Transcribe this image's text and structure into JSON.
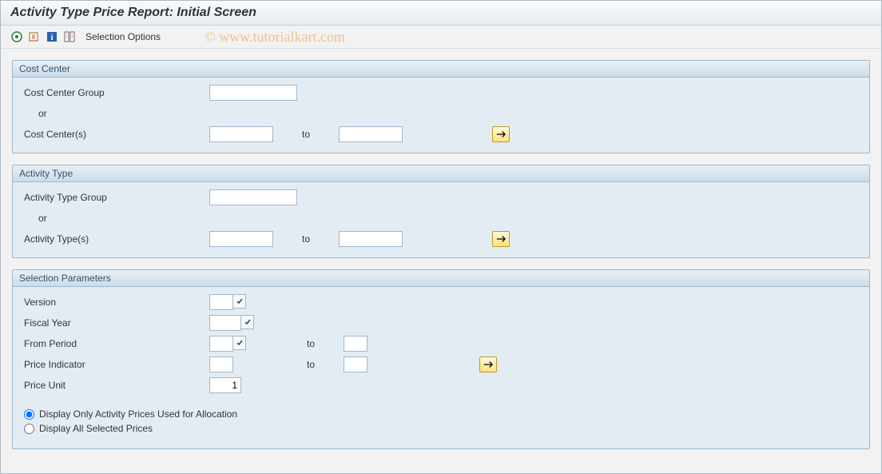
{
  "watermark": "© www.tutorialkart.com",
  "title": "Activity Type Price Report: Initial Screen",
  "toolbar": {
    "selection_options_label": "Selection Options"
  },
  "groups": {
    "cost_center": {
      "title": "Cost Center",
      "group_label": "Cost Center Group",
      "or_label": "or",
      "range_label": "Cost Center(s)",
      "to_label": "to",
      "group_value": "",
      "from_value": "",
      "to_value": ""
    },
    "activity_type": {
      "title": "Activity Type",
      "group_label": "Activity Type Group",
      "or_label": "or",
      "range_label": "Activity Type(s)",
      "to_label": "to",
      "group_value": "",
      "from_value": "",
      "to_value": ""
    },
    "selection_params": {
      "title": "Selection Parameters",
      "version_label": "Version",
      "fiscal_year_label": "Fiscal Year",
      "from_period_label": "From Period",
      "price_indicator_label": "Price Indicator",
      "price_unit_label": "Price Unit",
      "to_label": "to",
      "version_value": "",
      "fiscal_year_value": "",
      "from_period_value": "",
      "to_period_value": "",
      "price_indicator_from": "",
      "price_indicator_to": "",
      "price_unit_value": "1",
      "radio_allocation_label": "Display Only Activity Prices Used for Allocation",
      "radio_all_label": "Display All Selected Prices",
      "radio_selected": "allocation"
    }
  }
}
